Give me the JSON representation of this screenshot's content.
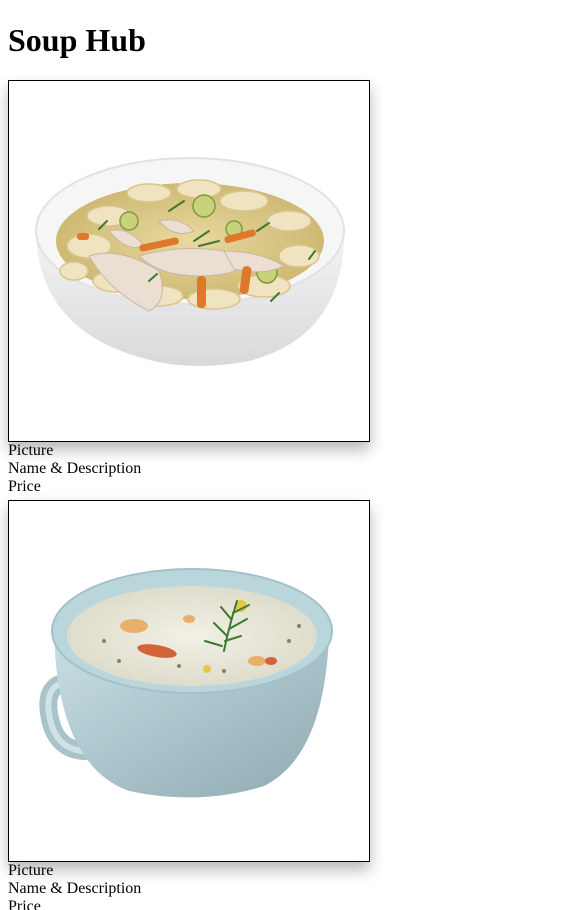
{
  "page": {
    "title": "Soup Hub"
  },
  "menu": {
    "items": [
      {
        "image": "chicken-noodle-soup-bowl",
        "picture_label": "Picture",
        "name_desc_label": "Name & Description",
        "price_label": "Price"
      },
      {
        "image": "creamy-chowder-cup",
        "picture_label": "Picture",
        "name_desc_label": "Name & Description",
        "price_label": "Price"
      }
    ]
  },
  "colors": {
    "text": "#000000",
    "background": "#ffffff",
    "frame_border": "#000000"
  }
}
